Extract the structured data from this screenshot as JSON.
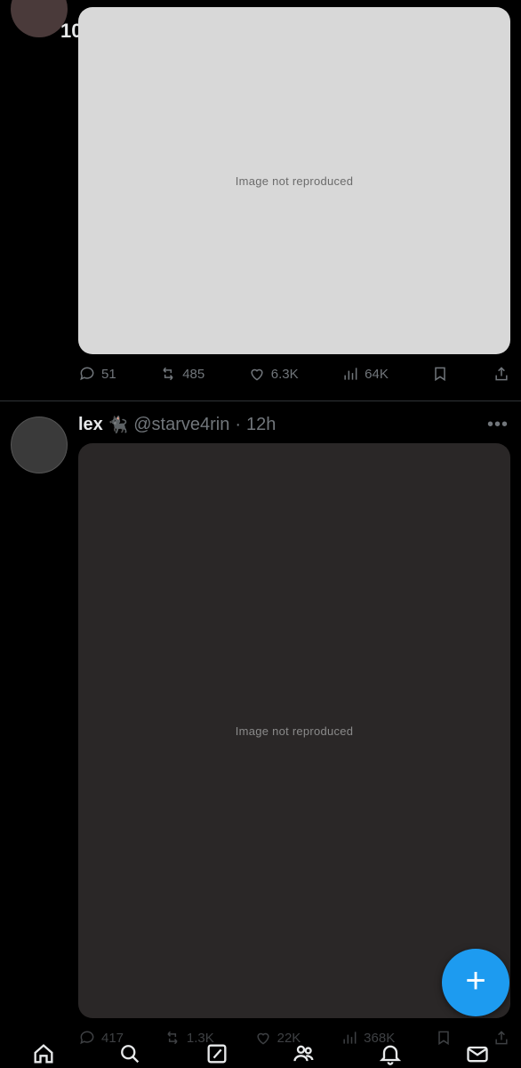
{
  "top_post": {
    "name_fragment": "10",
    "media_label": "Image not reproduced",
    "actions": {
      "replies": "51",
      "reposts": "485",
      "likes": "6.3K",
      "views": "64K"
    }
  },
  "second_post": {
    "display_name": "lex",
    "name_emoji": "🐈‍⬛",
    "handle": "@starve4rin",
    "separator": "·",
    "time": "12h",
    "more": "•••",
    "media_label": "Image not reproduced",
    "actions": {
      "replies": "417",
      "reposts": "1.3K",
      "likes": "22K",
      "views": "368K"
    }
  },
  "fab": {
    "label": "+"
  },
  "nav": [
    "home-icon",
    "search-icon",
    "grok-icon",
    "communities-icon",
    "notifications-icon",
    "messages-icon"
  ]
}
